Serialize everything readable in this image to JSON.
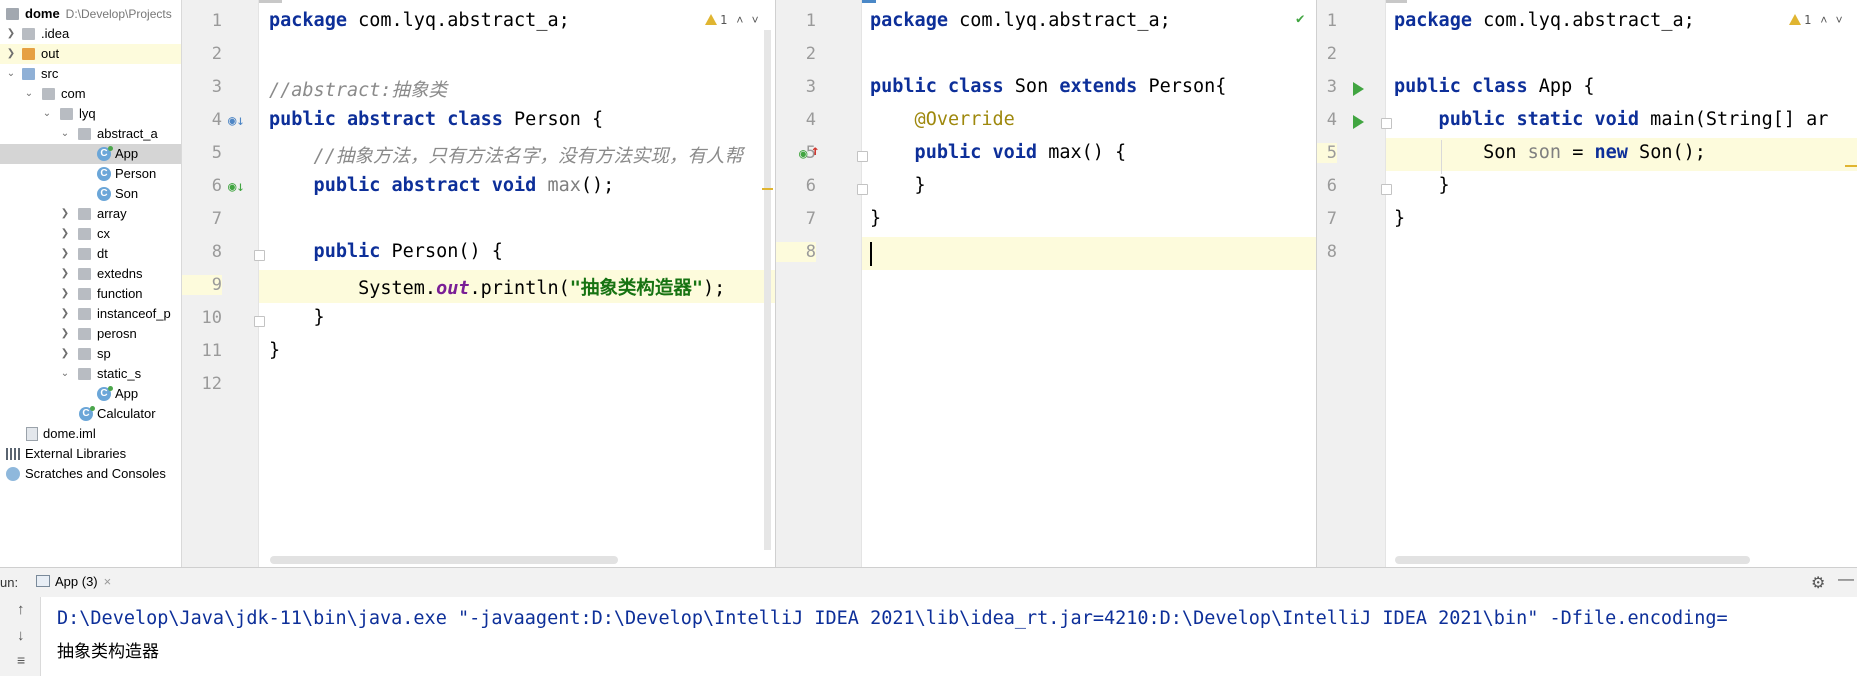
{
  "project_tree": {
    "root": {
      "name": "dome",
      "path": "D:\\Develop\\Projects"
    },
    "items": [
      {
        "label": ".idea"
      },
      {
        "label": "out"
      },
      {
        "label": "src"
      },
      {
        "label": "com"
      },
      {
        "label": "lyq"
      },
      {
        "label": "abstract_a"
      },
      {
        "label": "App"
      },
      {
        "label": "Person"
      },
      {
        "label": "Son"
      },
      {
        "label": "array"
      },
      {
        "label": "cx"
      },
      {
        "label": "dt"
      },
      {
        "label": "extedns"
      },
      {
        "label": "function"
      },
      {
        "label": "instanceof_p"
      },
      {
        "label": "perosn"
      },
      {
        "label": "sp"
      },
      {
        "label": "static_s"
      },
      {
        "label": "App"
      },
      {
        "label": "Calculator"
      },
      {
        "label": "dome.iml"
      },
      {
        "label": "External Libraries"
      },
      {
        "label": "Scratches and Consoles"
      }
    ]
  },
  "editor_left": {
    "warning_count": "1",
    "lines": {
      "l1_kw": "package",
      "l1_rest": " com.lyq.abstract_a;",
      "l3_comment": "//abstract:抽象类",
      "l4_kw": "public abstract class",
      "l4_rest": " Person {",
      "l5_comment": "    //抽象方法，只有方法名字，没有方法实现，有人帮",
      "l6_kw": "    public abstract void",
      "l6_name": " max",
      "l6_rest": "();",
      "l8_kw": "    public",
      "l8_rest": " Person() {",
      "l9_a": "        System.",
      "l9_field": "out",
      "l9_b": ".println(",
      "l9_str": "\"抽象类构造器\"",
      "l9_c": ");",
      "l10": "    }",
      "l11": "}"
    }
  },
  "editor_middle": {
    "lines": {
      "l1_kw": "package",
      "l1_rest": " com.lyq.abstract_a;",
      "l3_kw1": "public class",
      "l3_mid": " Son ",
      "l3_kw2": "extends",
      "l3_rest": " Person{",
      "l4_ann": "    @Override",
      "l5_kw": "    public void",
      "l5_rest": " max() {",
      "l6": "    }",
      "l7": "}"
    }
  },
  "editor_right": {
    "warning_count": "1",
    "lines": {
      "l1_kw": "package",
      "l1_rest": " com.lyq.abstract_a;",
      "l3_kw": "public class",
      "l3_rest": " App {",
      "l4_kw": "    public static void",
      "l4_rest": " main(String[] ar",
      "l5_a": "        Son ",
      "l5_var": "son",
      "l5_b": " = ",
      "l5_kw": "new",
      "l5_c": " Son();",
      "l6": "    }",
      "l7": "}"
    }
  },
  "run_panel": {
    "label": "un:",
    "tab": "App (3)",
    "console": [
      "D:\\Develop\\Java\\jdk-11\\bin\\java.exe \"-javaagent:D:\\Develop\\IntelliJ IDEA 2021\\lib\\idea_rt.jar=4210:D:\\Develop\\IntelliJ IDEA 2021\\bin\" -Dfile.encoding=",
      "抽象类构造器"
    ]
  },
  "colors": {
    "keyword": "#0d2f99",
    "string": "#177312",
    "comment": "#8a8a8a",
    "current_line": "#fdfbdc",
    "selection": "#d5d5d5"
  }
}
